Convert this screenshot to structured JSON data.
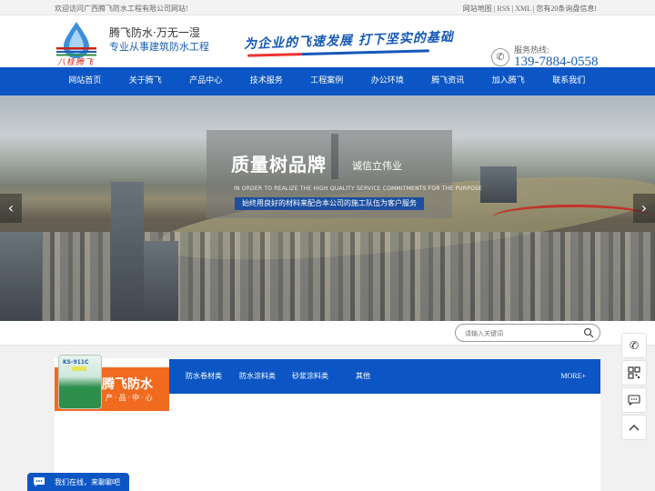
{
  "topbar": {
    "welcome": "欢迎访问广西腾飞防水工程有限公司网站!",
    "links": [
      "网站地图",
      "RSS",
      "XML"
    ],
    "inquiry": "您有20条询盘信息!"
  },
  "header": {
    "logo_text": "八桂腾飞",
    "brand_line1": "腾飞防水·万无一湿",
    "brand_line2": "专业从事建筑防水工程",
    "slogan": "为企业的飞速发展  打下坚实的基础",
    "hotline_label": "服务热线:",
    "hotline_number": "139-7884-0558"
  },
  "nav": {
    "items": [
      "网站首页",
      "关于腾飞",
      "产品中心",
      "技术服务",
      "工程案例",
      "办公环境",
      "腾飞资讯",
      "加入腾飞",
      "联系我们"
    ]
  },
  "banner": {
    "title": "质量树品牌",
    "subtitle": "诚信立伟业",
    "english": "IN ORDER TO REALIZE THE HIGH QUALITY SERVICE COMMITMENTS FOR THE PURPOSE",
    "bar_text": "始终用良好的材料来配合本公司的施工队伍为客户服务",
    "arrow_left": "‹",
    "arrow_right": "›"
  },
  "search": {
    "placeholder": "请输入关键词"
  },
  "products": {
    "bucket_label": "KS-911C",
    "title": "腾飞防水",
    "subtitle": "产·品·中·心",
    "categories": [
      "防水卷材类",
      "防水涂料类",
      "砂浆涂料类",
      "其他"
    ],
    "more": "MORE+"
  },
  "chat": {
    "text": "我们在线，来聊聊吧"
  },
  "colors": {
    "primary": "#0b56c4",
    "accent": "#f06a1f",
    "hotline": "#1a5fb4"
  }
}
